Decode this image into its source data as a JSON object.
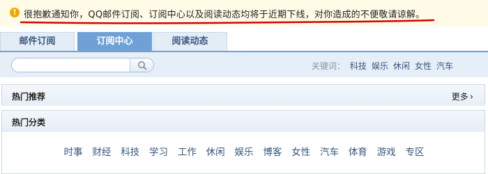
{
  "notice": {
    "icon": "warning-icon",
    "message": "很抱歉通知你，QQ邮件订阅、订阅中心以及阅读动态均将于近期下线，对你造成的不便敬请谅解。"
  },
  "tabs": [
    {
      "label": "邮件订阅",
      "active": false
    },
    {
      "label": "订阅中心",
      "active": true
    },
    {
      "label": "阅读动态",
      "active": false
    }
  ],
  "search": {
    "value": "",
    "placeholder": "",
    "button_icon": "search-icon"
  },
  "keywords": {
    "label": "关键词：",
    "items": [
      "科技",
      "娱乐",
      "休闲",
      "女性",
      "汽车"
    ]
  },
  "hot_recommend": {
    "title": "热门推荐",
    "more_label": "更多"
  },
  "hot_categories": {
    "title": "热门分类",
    "items": [
      "时事",
      "财经",
      "科技",
      "学习",
      "工作",
      "休闲",
      "娱乐",
      "博客",
      "女性",
      "汽车",
      "体育",
      "游戏",
      "专区"
    ]
  },
  "colors": {
    "accent": "#6fa0d6",
    "annotation": "#d40000",
    "notice_bg": "#fffbe6",
    "link": "#37587c"
  }
}
